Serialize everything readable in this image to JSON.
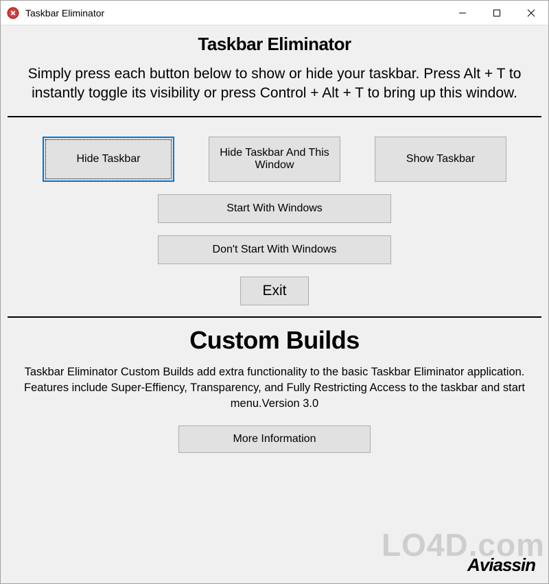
{
  "titlebar": {
    "title": "Taskbar Eliminator"
  },
  "header": {
    "app_title": "Taskbar Eliminator",
    "instructions": "Simply press each button below to show or hide your taskbar. Press Alt + T to instantly toggle its visibility or press Control + Alt + T to bring up this window."
  },
  "buttons": {
    "hide_taskbar": "Hide Taskbar",
    "hide_taskbar_window": "Hide Taskbar And This Window",
    "show_taskbar": "Show Taskbar",
    "start_with_windows": "Start With Windows",
    "dont_start_with_windows": "Don't Start With Windows",
    "exit": "Exit"
  },
  "custom": {
    "title": "Custom Builds",
    "description": "Taskbar Eliminator Custom Builds add extra functionality to the basic Taskbar Eliminator application. Features include Super-Effiency, Transparency, and Fully Restricting Access to the taskbar and start menu.Version 3.0",
    "more_info": "More Information"
  },
  "brand": "Aviassin",
  "watermark": "LO4D.com"
}
